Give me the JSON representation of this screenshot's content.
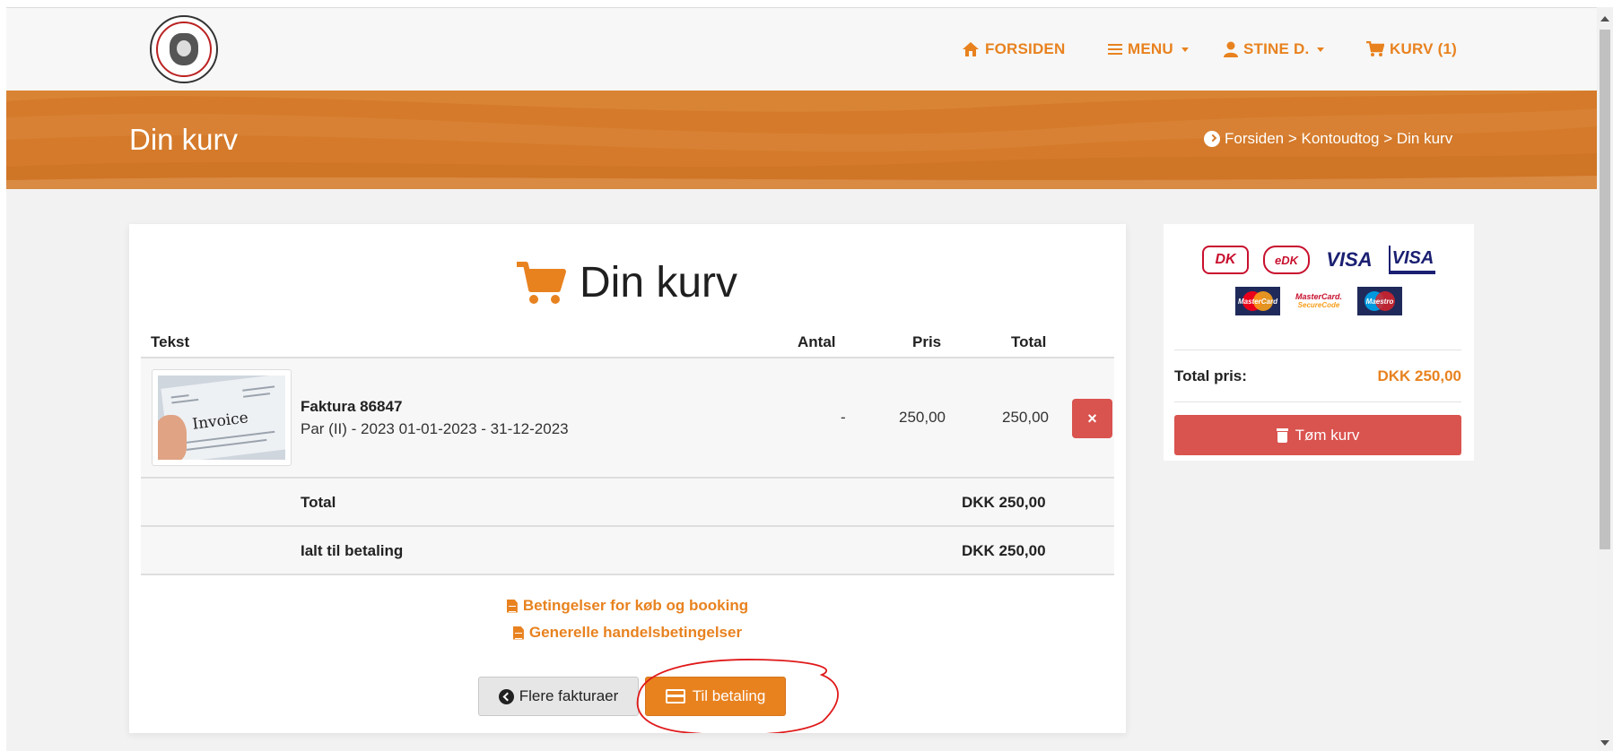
{
  "nav": {
    "home": "FORSIDEN",
    "menu": "MENU",
    "user": "STINE D.",
    "cart": "KURV (1)"
  },
  "banner": {
    "title": "Din kurv",
    "breadcrumb": "Forsiden > Kontoudtog > Din kurv"
  },
  "cart": {
    "title": "Din kurv",
    "columns": {
      "text": "Tekst",
      "qty": "Antal",
      "price": "Pris",
      "total": "Total"
    },
    "item": {
      "thumb_text": "Invoice",
      "name": "Faktura 86847",
      "description": "Par (II) - 2023 01-01-2023 - 31-12-2023",
      "qty": "-",
      "price": "250,00",
      "total": "250,00",
      "remove_label": "×"
    },
    "summary": [
      {
        "label": "Total",
        "value": "DKK 250,00"
      },
      {
        "label": "Ialt til betaling",
        "value": "DKK 250,00"
      }
    ],
    "links": {
      "terms_booking": "Betingelser for køb og booking",
      "terms_general": "Generelle handelsbetingelser"
    },
    "buttons": {
      "back": "Flere fakturaer",
      "pay": "Til betaling"
    }
  },
  "sidebar": {
    "payment_logos": {
      "dk": "DK",
      "edk": "eDK",
      "visa": "VISA",
      "visa_electron": "VISA",
      "mastercard": "MasterCard",
      "mc_securecode_top": "MasterCard.",
      "mc_securecode_bottom": "SecureCode",
      "maestro": "Maestro"
    },
    "total_label": "Total pris:",
    "total_value": "DKK 250,00",
    "empty_button": "Tøm kurv"
  },
  "colors": {
    "accent": "#e8821f",
    "banner": "#d47a2a",
    "danger": "#d9534f",
    "annotation": "#e0191a"
  }
}
